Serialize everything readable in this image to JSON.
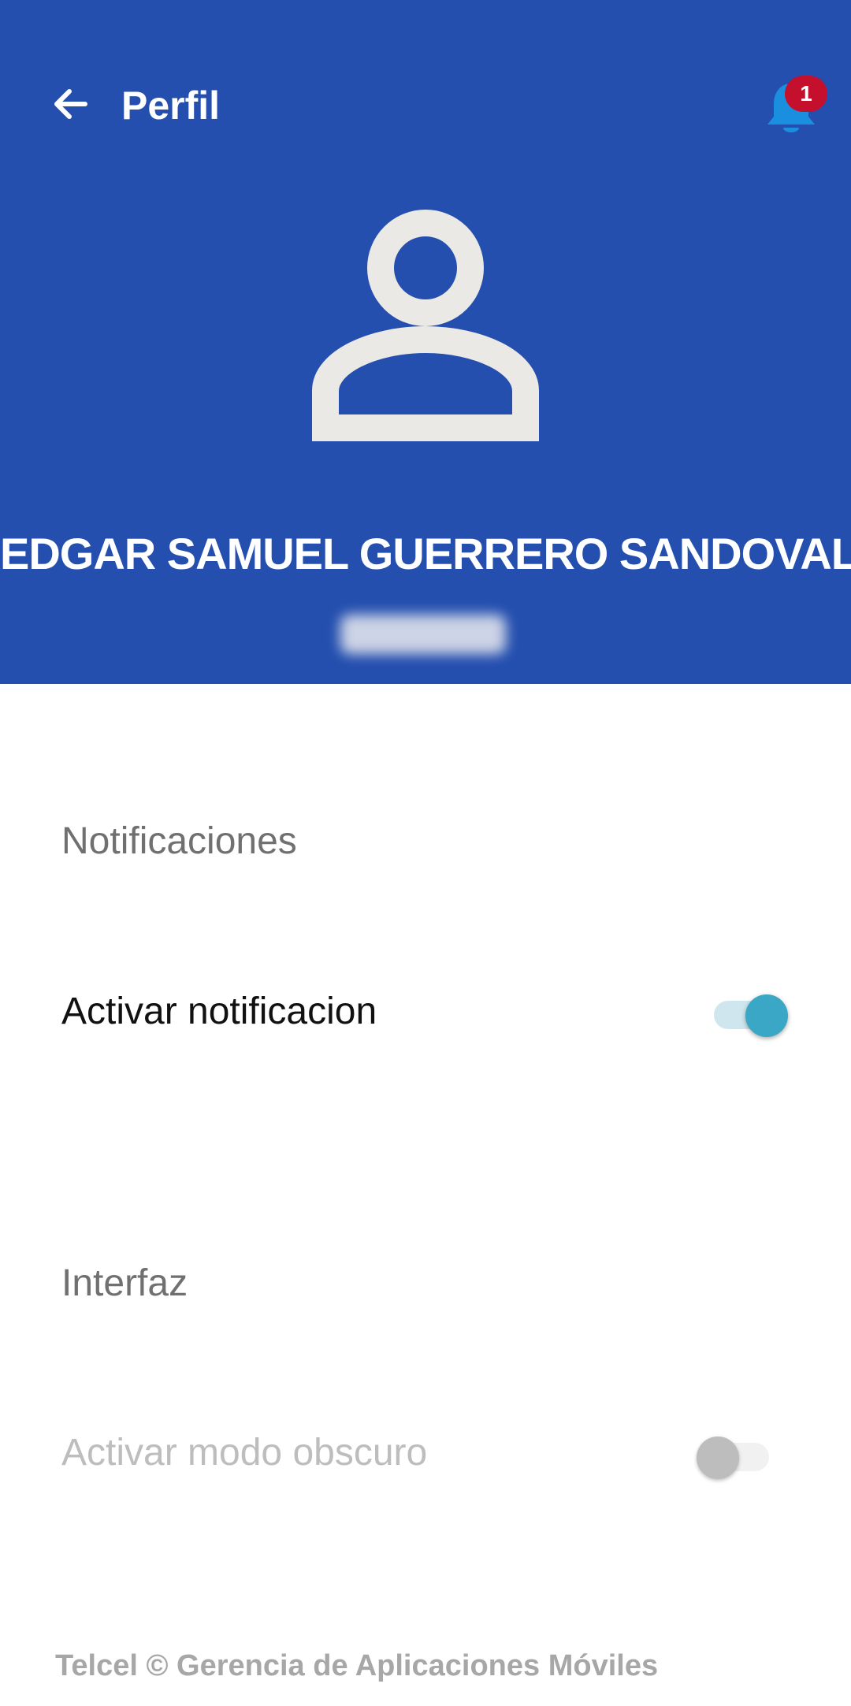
{
  "app_bar": {
    "title": "Perfil",
    "back_icon": "arrow-left-icon",
    "notification_icon": "bell-icon",
    "notification_count": "1"
  },
  "profile": {
    "avatar_icon": "user-outline-icon",
    "name": "EDGAR SAMUEL GUERRERO SANDOVAL",
    "employee_id": ""
  },
  "sections": {
    "notifications": {
      "title": "Notificaciones",
      "toggle_label": "Activar notificacion",
      "enabled": true
    },
    "interface": {
      "title": "Interfaz",
      "toggle_label": "Activar modo obscuro",
      "enabled": false,
      "disabled": true
    }
  },
  "footer": {
    "text": "Telcel © Gerencia de Aplicaciones Móviles"
  },
  "colors": {
    "header": "#244faf",
    "accent": "#3aa7c6",
    "badge": "#c4102c",
    "bell": "#1a8fe0"
  }
}
